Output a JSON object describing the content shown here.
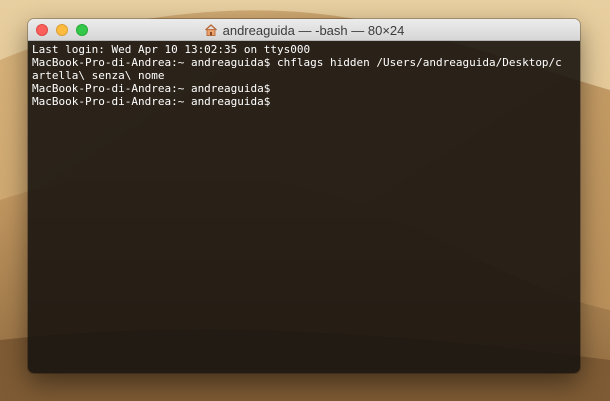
{
  "window": {
    "title": "andreaguida — -bash — 80×24",
    "title_icon": "home-folder-icon"
  },
  "terminal": {
    "lines": [
      "Last login: Wed Apr 10 13:02:35 on ttys000",
      "MacBook-Pro-di-Andrea:~ andreaguida$ chflags hidden /Users/andreaguida/Desktop/c",
      "artella\\ senza\\ nome",
      "MacBook-Pro-di-Andrea:~ andreaguida$",
      "MacBook-Pro-di-Andrea:~ andreaguida$"
    ]
  },
  "colors": {
    "close": "#fc605c",
    "minimize": "#fdbc40",
    "zoom": "#34c84a",
    "terminal_background": "#181410",
    "terminal_text": "#ffffff"
  }
}
